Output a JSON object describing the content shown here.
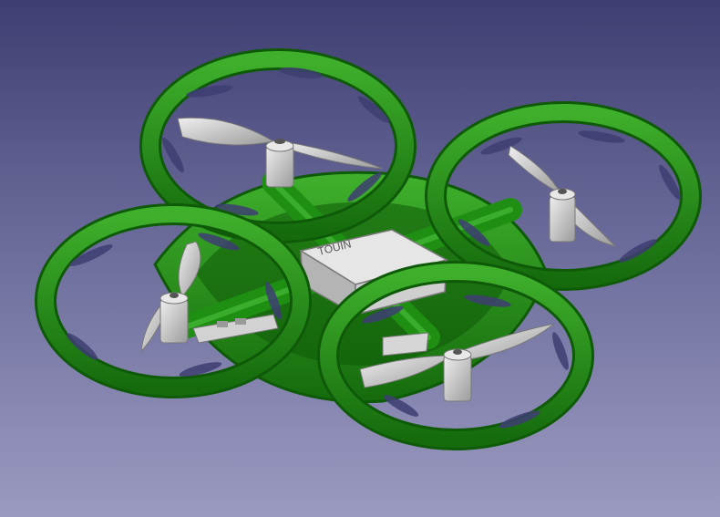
{
  "viewport": {
    "background_top": "#3e3e72",
    "background_bottom": "#9a9ac0"
  },
  "model": {
    "frame_color": "#1f8f14",
    "frame_shadow": "#0e5a08",
    "frame_highlight": "#4fc23c",
    "part_color": "#c9c9c9",
    "part_shadow": "#8d8d8d",
    "part_highlight": "#eeeeee",
    "board_label": "TOUIN"
  },
  "icons": {
    "propeller": "propeller-icon",
    "motor": "motor-icon",
    "guard": "prop-guard-icon"
  }
}
